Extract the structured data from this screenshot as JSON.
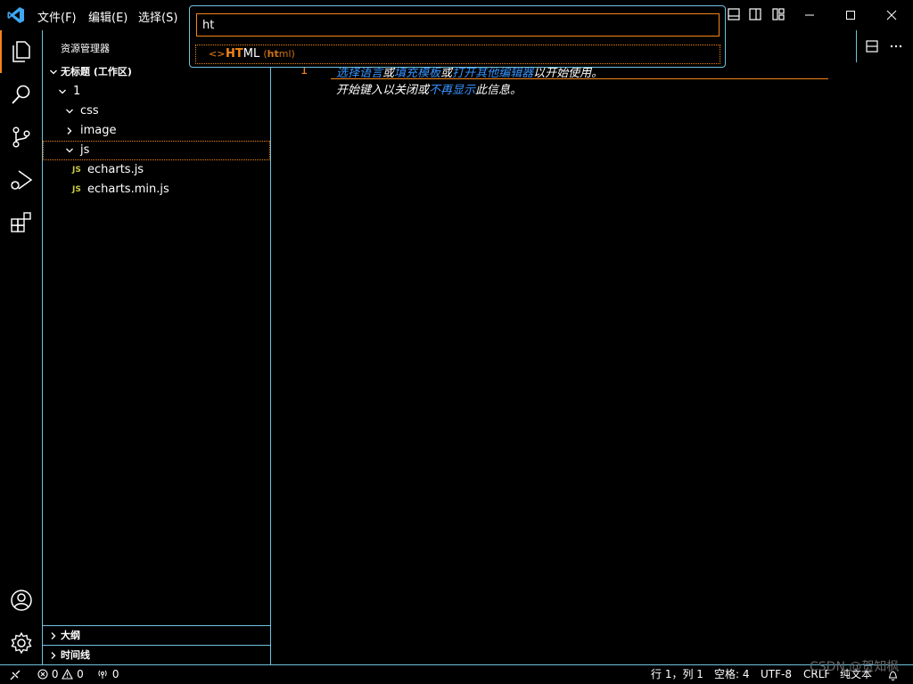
{
  "menu": {
    "file": "文件(F)",
    "edit": "编辑(E)",
    "selection": "选择(S)"
  },
  "quickpick": {
    "input_value": "ht",
    "item_match": "HT",
    "item_rest": "ML",
    "item_desc": "(html)",
    "item_desc_match": "ht",
    "item_desc_rest": "ml"
  },
  "sidebar": {
    "title": "资源管理器",
    "workspace": "无标题 (工作区)",
    "tree": {
      "root": "1",
      "css": "css",
      "image": "image",
      "js": "js",
      "file1_badge": "JS",
      "file1": "echarts.js",
      "file2_badge": "JS",
      "file2": "echarts.min.js"
    },
    "outline": "大纲",
    "timeline": "时间线"
  },
  "editor": {
    "line_number": "1",
    "hint_line1_a": "选择语言",
    "hint_line1_b": "或",
    "hint_line1_c": "填充模板",
    "hint_line1_d": "或",
    "hint_line1_e": "打开其他编辑器",
    "hint_line1_f": "以开始使用。",
    "hint_line2_a": "开始键入以关闭或",
    "hint_line2_b": "不再显示",
    "hint_line2_c": "此信息。"
  },
  "statusbar": {
    "errors": "0",
    "warnings": "0",
    "ports": "0",
    "position": "行 1，列 1",
    "spaces": "空格: 4",
    "encoding": "UTF-8",
    "eol": "CRLF",
    "language": "纯文本"
  },
  "watermark": "CSDN @贺知枫",
  "colors": {
    "accent": "#6fc3df",
    "focus": "#f38518",
    "link": "#3794ff",
    "js_badge": "#cbcb41"
  }
}
